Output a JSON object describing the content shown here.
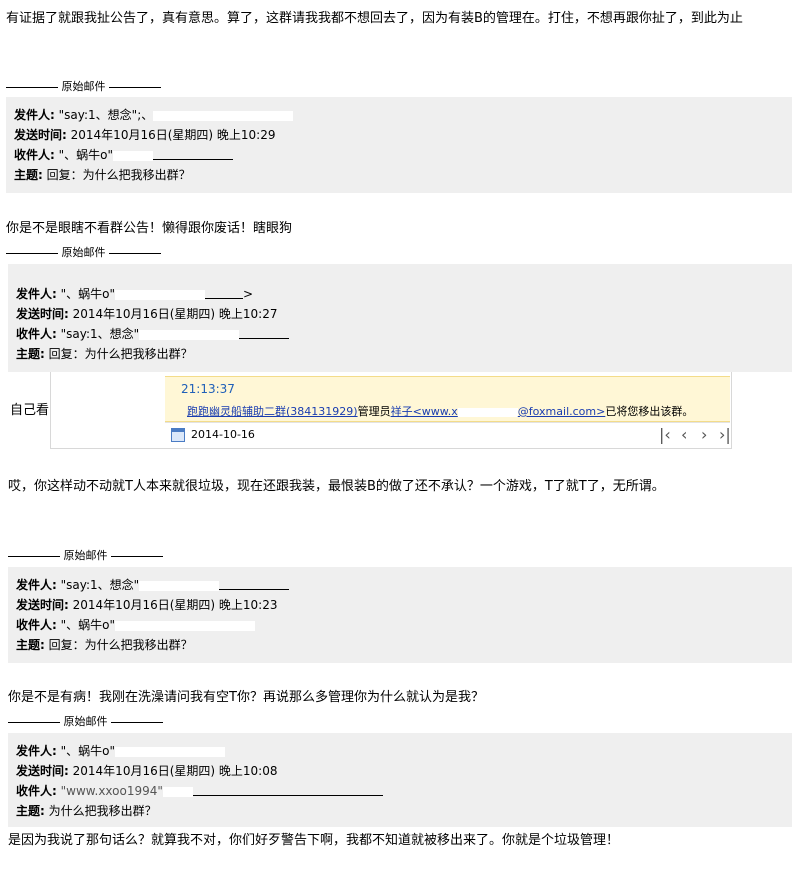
{
  "line_top": "有证据了就跟我扯公告了，真有意思。算了，这群请我我都不想回去了，因为有装B的管理在。打住，不想再跟你扯了，到此为止",
  "divider_label": "原始邮件",
  "labels": {
    "from": "发件人:",
    "sent": "发送时间:",
    "to": "收件人:",
    "subject": "主题:"
  },
  "headers": [
    {
      "from": "\"say:1、想念\";、",
      "sent": "2014年10月16日(星期四) 晚上10:29",
      "to": "\"、蜗牛o\"",
      "subject": "回复：为什么把我移出群？"
    },
    {
      "from": "\"、蜗牛o\"",
      "from_tail": ">",
      "sent": "2014年10月16日(星期四) 晚上10:27",
      "to": "\"say:1、想念\"",
      "subject": "回复：为什么把我移出群？"
    },
    {
      "from": "\"say:1、想念\"",
      "sent": "2014年10月16日(星期四) 晚上10:23",
      "to": "\"、蜗牛o\"",
      "subject": "回复：为什么把我移出群？"
    },
    {
      "from": "\"、蜗牛o\"",
      "sent": "2014年10月16日(星期四) 晚上10:08",
      "to": "\"www.xxoo1994\"",
      "subject": "为什么把我移出群？"
    }
  ],
  "line_blind": "你是不是眼瞎不看群公告！懒得跟你废话！瞎眼狗",
  "line_self_look": "自己看",
  "screenshot": {
    "time": "21:13:37",
    "group_link": "跑跑幽灵船辅助二群(384131929)",
    "admin_word": "管理员",
    "admin_link": "祥子<www.x",
    "admin_link_tail": "@foxmail.com>",
    "tail": "已将您移出该群。",
    "date": "2014-10-16"
  },
  "line_angry": "哎，你这样动不动就T人本来就很垃圾，现在还跟我装，最恨装B的做了还不承认？一个游戏，T了就T了，无所谓。",
  "line_sick": "你是不是有病！我刚在洗澡请问我有空T你？再说那么多管理你为什么就认为是我？",
  "line_last": "是因为我说了那句话么？就算我不对，你们好歹警告下啊，我都不知道就被移出来了。你就是个垃圾管理！"
}
